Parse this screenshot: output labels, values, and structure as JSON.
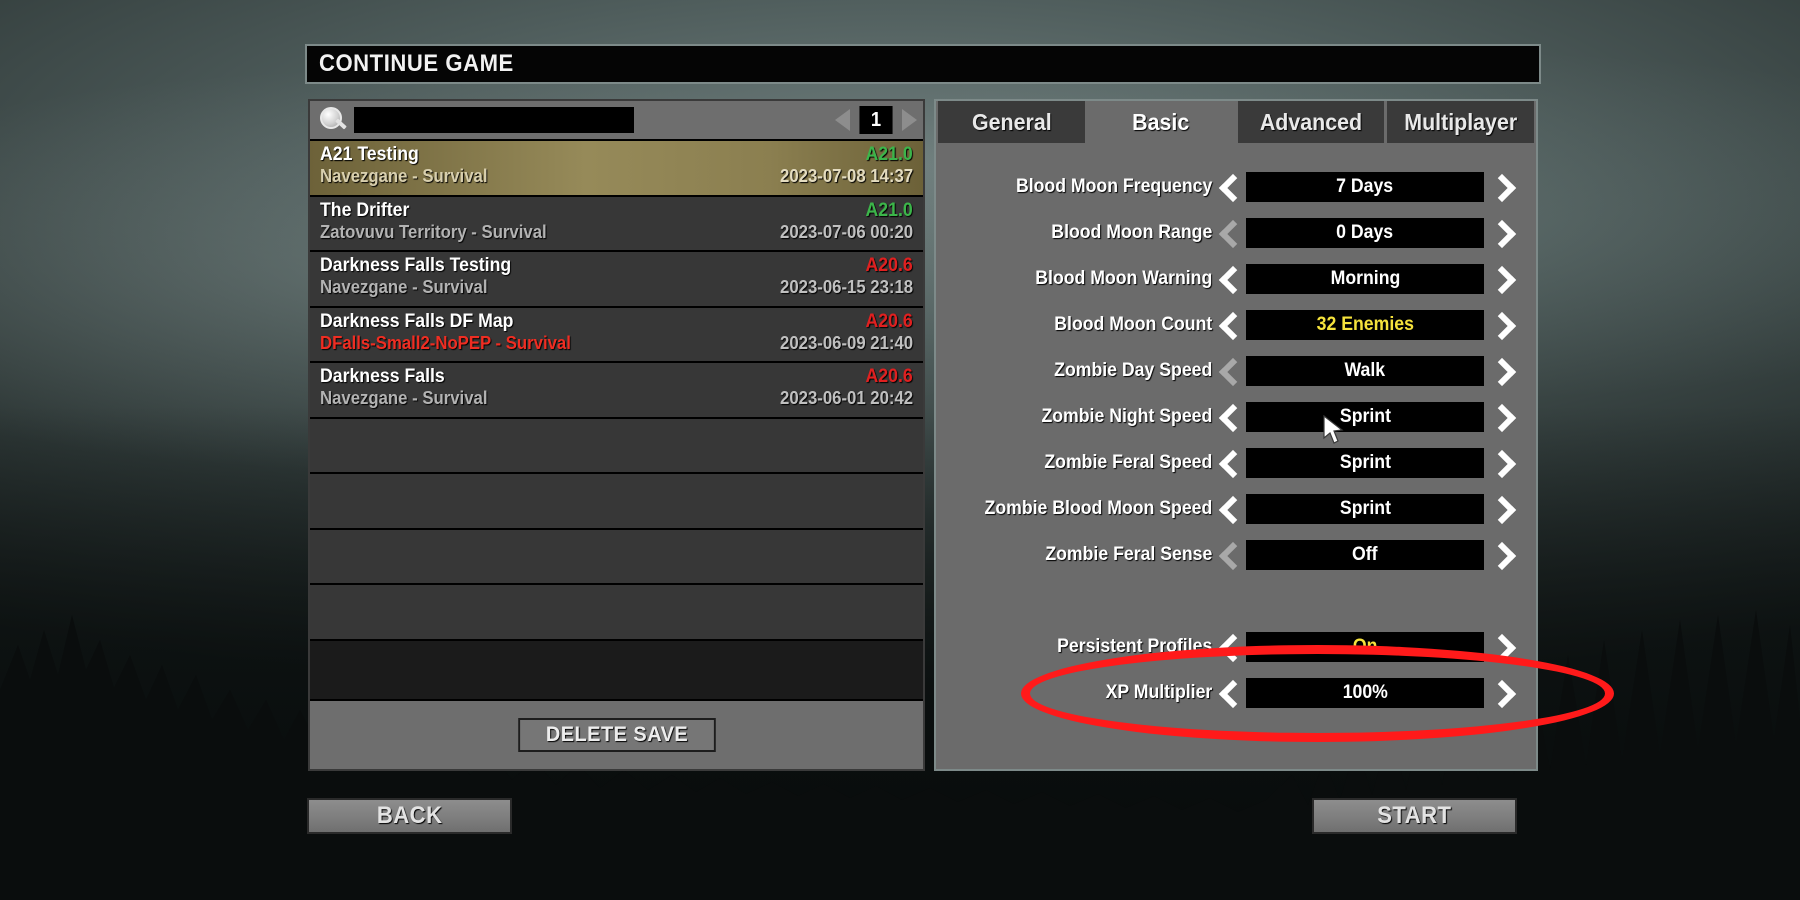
{
  "window": {
    "title": "CONTINUE GAME"
  },
  "saves_panel": {
    "search": {
      "value": "",
      "placeholder": "",
      "icon": "search-icon"
    },
    "pager": {
      "page": "1",
      "prev_icon": "triangle-left-icon",
      "next_icon": "triangle-right-icon"
    },
    "delete_label": "DELETE SAVE",
    "rows": [
      {
        "name": "A21 Testing",
        "version": "A21.0",
        "version_color": "green",
        "subtitle": "Navezgane - Survival",
        "subtitle_color": "normal",
        "date": "2023-07-08 14:37",
        "selected": true
      },
      {
        "name": "The Drifter",
        "version": "A21.0",
        "version_color": "green",
        "subtitle": "Zatovuvu Territory - Survival",
        "subtitle_color": "normal",
        "date": "2023-07-06 00:20",
        "selected": false
      },
      {
        "name": "Darkness Falls Testing",
        "version": "A20.6",
        "version_color": "red",
        "subtitle": "Navezgane - Survival",
        "subtitle_color": "normal",
        "date": "2023-06-15 23:18",
        "selected": false
      },
      {
        "name": "Darkness Falls DF Map",
        "version": "A20.6",
        "version_color": "red",
        "subtitle": "DFalls-Small2-NoPEP - Survival",
        "subtitle_color": "red",
        "date": "2023-06-09 21:40",
        "selected": false
      },
      {
        "name": "Darkness Falls",
        "version": "A20.6",
        "version_color": "red",
        "subtitle": "Navezgane - Survival",
        "subtitle_color": "normal",
        "date": "2023-06-01 20:42",
        "selected": false
      }
    ],
    "empty_rows": 4
  },
  "settings_panel": {
    "tabs": [
      {
        "label": "General",
        "active": false
      },
      {
        "label": "Basic",
        "active": true
      },
      {
        "label": "Advanced",
        "active": false
      },
      {
        "label": "Multiplayer",
        "active": false
      }
    ],
    "rows": [
      {
        "label": "Blood Moon Frequency",
        "value": "7 Days",
        "value_color": "white",
        "left_enabled": true,
        "right_enabled": true
      },
      {
        "label": "Blood Moon Range",
        "value": "0 Days",
        "value_color": "white",
        "left_enabled": false,
        "right_enabled": true
      },
      {
        "label": "Blood Moon Warning",
        "value": "Morning",
        "value_color": "white",
        "left_enabled": true,
        "right_enabled": true
      },
      {
        "label": "Blood Moon Count",
        "value": "32 Enemies",
        "value_color": "yellow",
        "left_enabled": true,
        "right_enabled": true
      },
      {
        "label": "Zombie Day Speed",
        "value": "Walk",
        "value_color": "white",
        "left_enabled": false,
        "right_enabled": true
      },
      {
        "label": "Zombie Night Speed",
        "value": "Sprint",
        "value_color": "white",
        "left_enabled": true,
        "right_enabled": true
      },
      {
        "label": "Zombie Feral Speed",
        "value": "Sprint",
        "value_color": "white",
        "left_enabled": true,
        "right_enabled": true
      },
      {
        "label": "Zombie Blood Moon Speed",
        "value": "Sprint",
        "value_color": "white",
        "left_enabled": true,
        "right_enabled": true
      },
      {
        "label": "Zombie Feral Sense",
        "value": "Off",
        "value_color": "white",
        "left_enabled": false,
        "right_enabled": true
      },
      {
        "label": "",
        "value": "",
        "value_color": "white",
        "spacer": true
      },
      {
        "label": "Persistent Profiles",
        "value": "On",
        "value_color": "yellow",
        "left_enabled": true,
        "right_enabled": true
      },
      {
        "label": "XP Multiplier",
        "value": "100%",
        "value_color": "white",
        "left_enabled": true,
        "right_enabled": true
      }
    ]
  },
  "footer": {
    "back_label": "BACK",
    "start_label": "START"
  },
  "annotation": {
    "shape": "ellipse",
    "color": "#ff1a1a",
    "targets": "XP Multiplier"
  }
}
